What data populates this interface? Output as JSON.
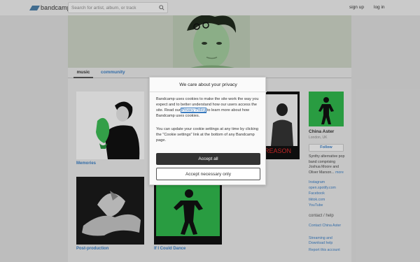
{
  "header": {
    "logo_text": "bandcamp",
    "search_placeholder": "Search for artist, album, or track",
    "signup_label": "sign up",
    "login_label": "log in"
  },
  "tabs": {
    "music": "music",
    "community": "community"
  },
  "albums": [
    {
      "title": "Memories"
    },
    {
      "title": "Post-production"
    },
    {
      "title": "If I Could Dance"
    },
    {
      "cover_text": "REASON"
    }
  ],
  "artist": {
    "name": "China Aster",
    "location": "London, UK",
    "follow_label": "Follow",
    "bio": "Synthy alternative pop band comprising Joshua Moore and Oliver Marson...",
    "bio_more": "more",
    "links": [
      "Instagram",
      "open.spotify.com",
      "Facebook",
      "tiktok.com",
      "YouTube"
    ]
  },
  "contact": {
    "heading": "contact / help",
    "contact_link": "Contact China Aster",
    "streaming_link": "Streaming and Download help",
    "report_link": "Report this account"
  },
  "cookie_modal": {
    "title": "We care about your privacy",
    "para1_before": "Bandcamp uses cookies to make the site work the way you expect and to better understand how our users access the site. Read our ",
    "policy_link": "Privacy Policy",
    "para1_after": " to learn more about how Bandcamp uses cookies.",
    "para2": "You can update your cookie settings at any time by clicking the \"Cookie settings\" link at the bottom of any Bandcamp page.",
    "accept_all": "Accept all",
    "accept_necessary": "Accept necessary only"
  },
  "colors": {
    "link": "#3a7bbf",
    "accent_green": "#2fb24a",
    "brand": "#4b7ca3"
  }
}
